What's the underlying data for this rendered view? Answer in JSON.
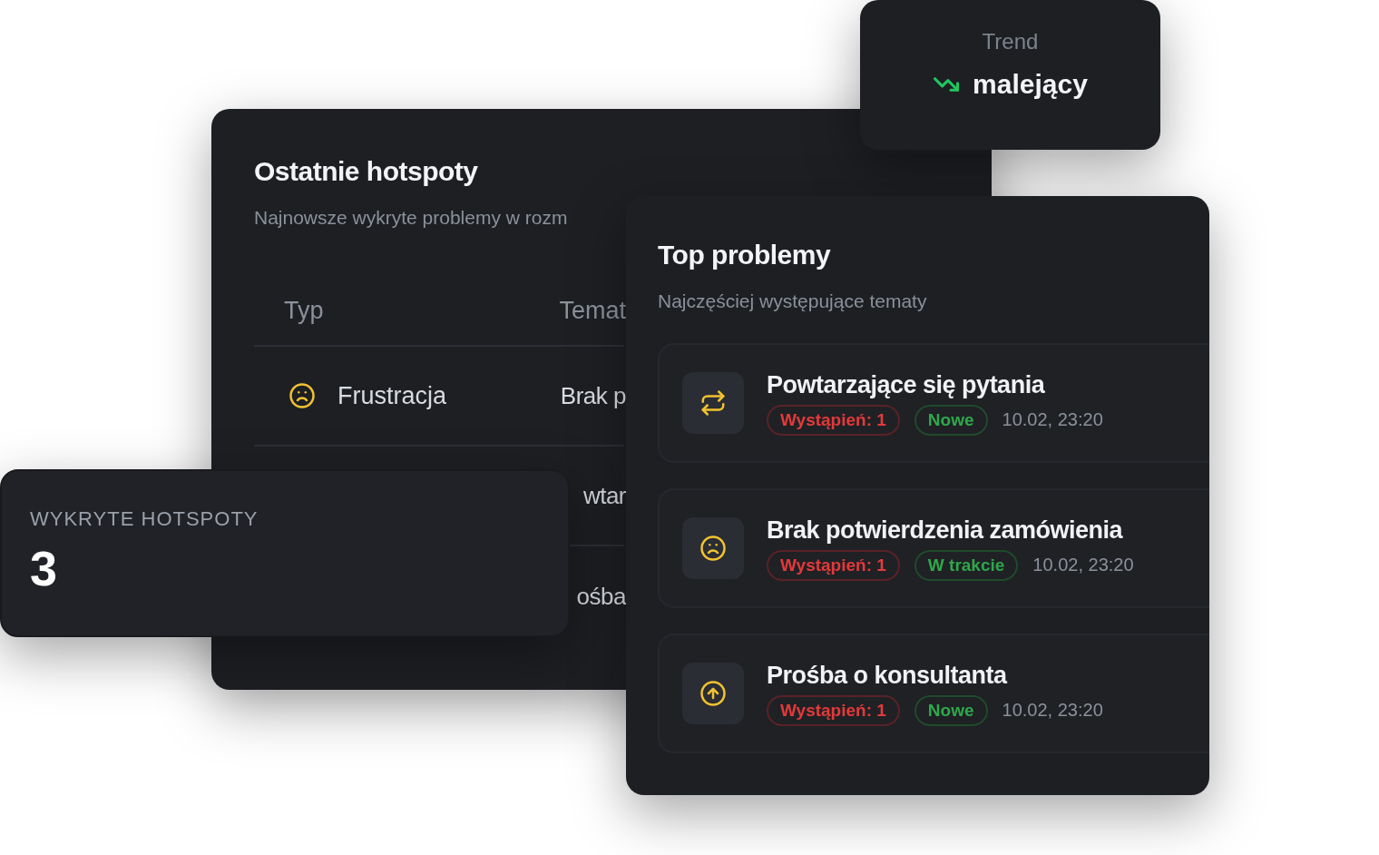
{
  "recent_hotspots": {
    "title": "Ostatnie hotspoty",
    "subtitle": "Najnowsze wykryte problemy w rozm",
    "columns": [
      "Typ",
      "Temat"
    ],
    "rows": [
      {
        "type": {
          "kind": "frown",
          "label": "Frustracja"
        },
        "topic": "Brak p"
      },
      {
        "topic": "wtar"
      },
      {
        "topic": "ośba"
      }
    ]
  },
  "trend": {
    "label": "Trend",
    "value": "malejący",
    "kind": "down"
  },
  "top_problems": {
    "title": "Top problemy",
    "subtitle": "Najczęściej występujące tematy",
    "items": [
      {
        "kind": "repeat",
        "title": "Powtarzające się pytania",
        "count": "Wystąpień: 1",
        "status": "Nowe",
        "time": "10.02, 23:20"
      },
      {
        "kind": "frown",
        "title": "Brak potwierdzenia zamówienia",
        "count": "Wystąpień: 1",
        "status": "W trakcie",
        "time": "10.02, 23:20"
      },
      {
        "kind": "escalate",
        "title": "Prośba o konsultanta",
        "count": "Wystąpień: 1",
        "status": "Nowe",
        "time": "10.02, 23:20"
      }
    ]
  },
  "detected": {
    "label": "WYKRYTE HOTSPOTY",
    "value": "3"
  }
}
